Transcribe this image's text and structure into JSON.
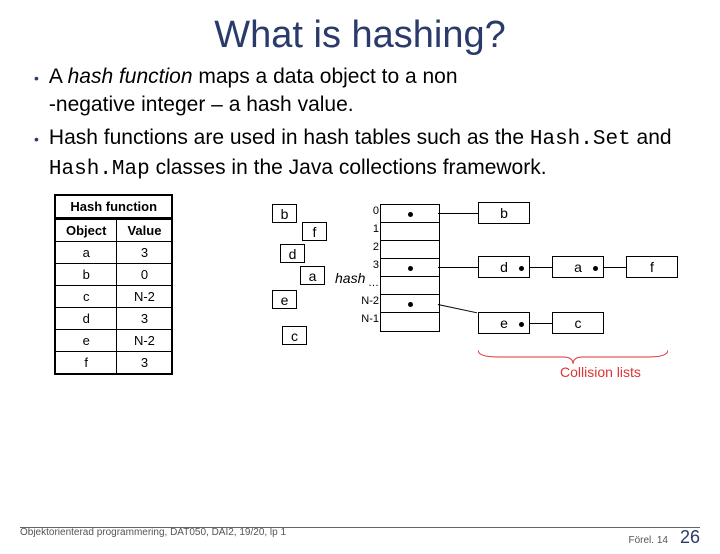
{
  "title": "What is hashing?",
  "bullet1_a": "A ",
  "bullet1_b": "hash function",
  "bullet1_c": " maps a data object to a non",
  "bullet1_d": "-negative integer – a hash value.",
  "bullet2_a": "Hash functions are used in hash tables such as the ",
  "bullet2_b": "Hash.Set",
  "bullet2_c": " and ",
  "bullet2_d": "Hash.Map",
  "bullet2_e": " classes in the Java collections framework.",
  "table": {
    "caption": "Hash function",
    "hdr_obj": "Object",
    "hdr_val": "Value",
    "rows": [
      {
        "o": "a",
        "v": "3"
      },
      {
        "o": "b",
        "v": "0"
      },
      {
        "o": "c",
        "v": "N-2"
      },
      {
        "o": "d",
        "v": "3"
      },
      {
        "o": "e",
        "v": "N-2"
      },
      {
        "o": "f",
        "v": "3"
      }
    ]
  },
  "diagram": {
    "in_b": "b",
    "in_f": "f",
    "in_d": "d",
    "in_a": "a",
    "in_e": "e",
    "in_c": "c",
    "idx_0": "0",
    "idx_1": "1",
    "idx_2": "2",
    "idx_3": "3",
    "idx_dots": "…",
    "idx_n2": "N-2",
    "idx_n1": "N-1",
    "hash_label": "hash",
    "bk_b": "b",
    "bk_d": "d",
    "bk_a": "a",
    "bk_f": "f",
    "bk_e": "e",
    "bk_c": "c",
    "collision": "Collision lists"
  },
  "footer": {
    "left": "Objektorienterad programmering, DAT050, DAI2, 19/20, lp 1",
    "right": "Förel. 14",
    "page": "26"
  }
}
